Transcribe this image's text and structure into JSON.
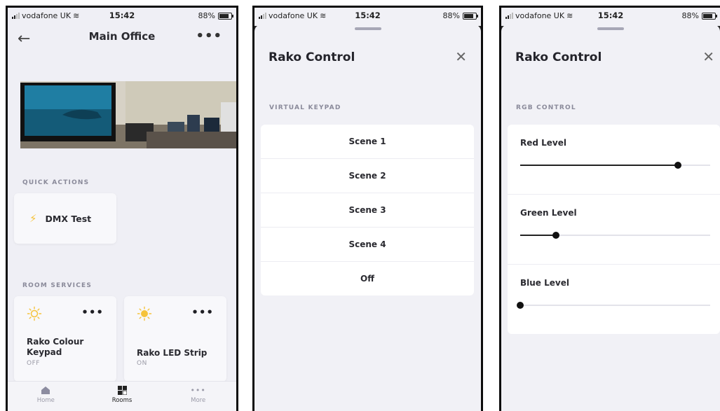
{
  "status_bar": {
    "carrier": "vodafone UK",
    "time": "15:42",
    "battery": "88%"
  },
  "room_screen": {
    "title": "Main Office",
    "quick_actions_label": "QUICK ACTIONS",
    "quick_actions": [
      {
        "label": "DMX Test",
        "icon": "lightning-bolt-icon"
      }
    ],
    "room_services_label": "ROOM SERVICES",
    "services": [
      {
        "name": "Rako Colour Keypad",
        "state": "OFF",
        "icon": "bulb-icon",
        "icon_color": "#f5c33b"
      },
      {
        "name": "Rako LED Strip",
        "state": "ON",
        "icon": "bulb-icon",
        "icon_color": "#f5c33b"
      }
    ],
    "tabs": [
      {
        "label": "Home",
        "icon": "home-icon"
      },
      {
        "label": "Rooms",
        "icon": "rooms-grid-icon"
      },
      {
        "label": "More",
        "icon": "more-dots-icon"
      }
    ]
  },
  "keypad_sheet": {
    "title": "Rako Control",
    "section_label": "VIRTUAL KEYPAD",
    "scenes": [
      "Scene 1",
      "Scene 2",
      "Scene 3",
      "Scene 4",
      "Off"
    ]
  },
  "rgb_sheet": {
    "title": "Rako Control",
    "section_label": "RGB CONTROL",
    "sliders": [
      {
        "label": "Red Level",
        "value": 0.83
      },
      {
        "label": "Green Level",
        "value": 0.19
      },
      {
        "label": "Blue Level",
        "value": 0.0
      }
    ]
  }
}
